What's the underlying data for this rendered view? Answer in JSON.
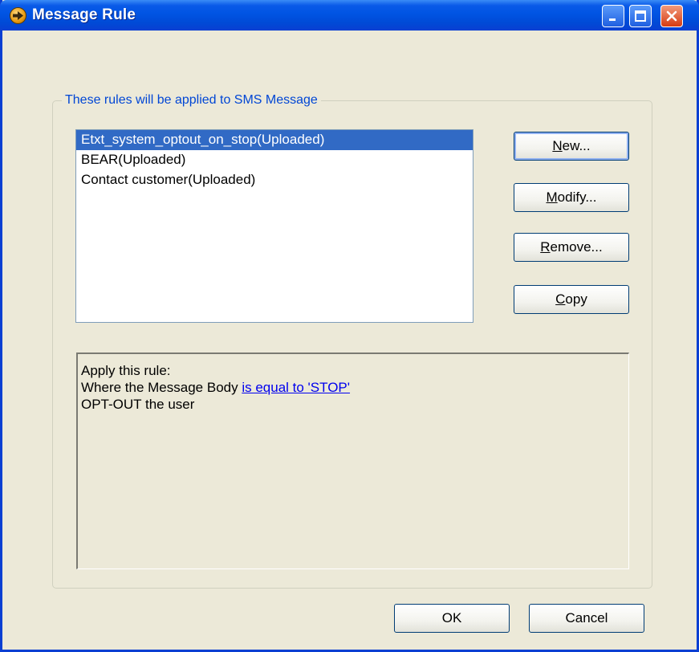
{
  "window": {
    "title": "Message Rule"
  },
  "group": {
    "label": "These rules will be applied to SMS Message"
  },
  "rules": [
    {
      "label": "Etxt_system_optout_on_stop(Uploaded)",
      "selected": true
    },
    {
      "label": "BEAR(Uploaded)",
      "selected": false
    },
    {
      "label": "Contact customer(Uploaded)",
      "selected": false
    }
  ],
  "buttons": {
    "new": {
      "mnemonic": "N",
      "rest": "ew..."
    },
    "modify": {
      "mnemonic": "M",
      "rest": "odify..."
    },
    "remove": {
      "mnemonic": "R",
      "rest": "emove..."
    },
    "copy": {
      "mnemonic": "C",
      "rest": "opy"
    },
    "ok": "OK",
    "cancel": "Cancel"
  },
  "description": {
    "line1": "Apply this rule:",
    "line2_prefix": "Where the Message Body ",
    "line2_link": "is equal to 'STOP'",
    "line3": "OPT-OUT the user"
  },
  "colors": {
    "titlebar": "#0054e3",
    "selection": "#316ac5",
    "link": "#0000ee",
    "group_label": "#0046d5"
  }
}
